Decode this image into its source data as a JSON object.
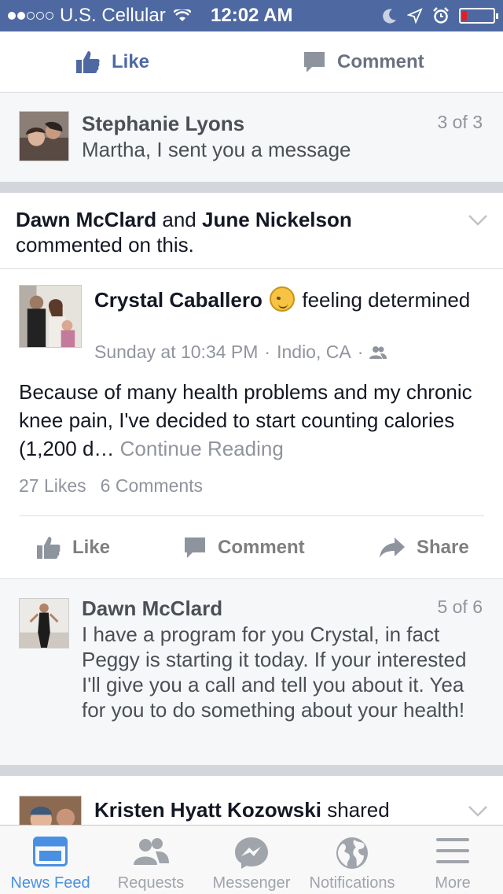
{
  "status_bar": {
    "carrier": "U.S. Cellular",
    "time": "12:02 AM"
  },
  "top_actions": {
    "like": "Like",
    "comment": "Comment"
  },
  "comment1": {
    "name": "Stephanie Lyons",
    "text": "Martha, I sent you a message",
    "count": "3 of 3"
  },
  "story": {
    "header": {
      "name1": "Dawn McClard",
      "and": "and",
      "name2": "June Nickelson",
      "action": "commented on this."
    },
    "author": "Crystal Caballero",
    "feeling": "feeling determined",
    "time": "Sunday at 10:34 PM",
    "location": "Indio, CA",
    "body": "Because of many health problems and my chronic knee pain, I've decided to start counting calories (1,200 d…",
    "continue": "Continue Reading",
    "likes": "27 Likes",
    "comments": "6 Comments",
    "actions": {
      "like": "Like",
      "comment": "Comment",
      "share": "Share"
    }
  },
  "comment2": {
    "name": "Dawn McClard",
    "text": "I have a program for you Crystal,  in fact Peggy is starting it today.  If your interested I'll give you a call and tell you about it.  Yea for you to do something about your health!",
    "count": "5 of 6"
  },
  "next_story": {
    "name": "Kristen Hyatt Kozowski",
    "action": "shared"
  },
  "tabs": [
    {
      "label": "News Feed",
      "icon": "news-feed-icon"
    },
    {
      "label": "Requests",
      "icon": "requests-icon"
    },
    {
      "label": "Messenger",
      "icon": "messenger-icon"
    },
    {
      "label": "Notifications",
      "icon": "globe-icon"
    },
    {
      "label": "More",
      "icon": "menu-icon"
    }
  ],
  "colors": {
    "status_bar": "#4e69a2",
    "link_blue": "#4e69a2",
    "active_tab": "#4a90e2",
    "secondary_text": "#90949c"
  }
}
